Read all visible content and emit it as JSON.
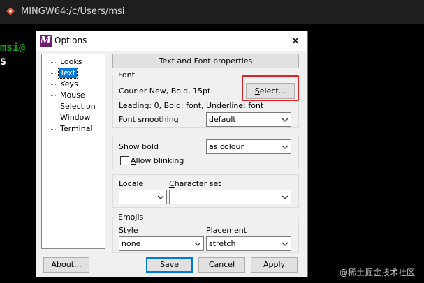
{
  "terminal": {
    "title": "MINGW64:/c/Users/msi",
    "line1": "msi@",
    "line2": "$"
  },
  "dialog": {
    "title": "Options",
    "close_glyph": "✕",
    "tree": [
      "Looks",
      "Text",
      "Keys",
      "Mouse",
      "Selection",
      "Window",
      "Terminal"
    ],
    "tree_selected": "Text",
    "header_button": "Text and Font properties",
    "font_group": {
      "label": "Font",
      "font_desc": "Courier New, Bold, 15pt",
      "select_button": "Select...",
      "leading_desc": "Leading: 0, Bold: font, Underline: font",
      "smoothing_label": "Font smoothing",
      "smoothing_value": "default"
    },
    "bold_group": {
      "show_bold_label": "Show bold",
      "show_bold_value": "as colour",
      "allow_blinking_label": "Allow blinking",
      "allow_blinking_checked": false
    },
    "locale_group": {
      "locale_label": "Locale",
      "locale_value": "",
      "charset_label": "Character set",
      "charset_value": ""
    },
    "emojis_group": {
      "label": "Emojis",
      "style_label": "Style",
      "style_value": "none",
      "placement_label": "Placement",
      "placement_value": "stretch"
    },
    "buttons": {
      "about": "About...",
      "save": "Save",
      "cancel": "Cancel",
      "apply": "Apply"
    }
  },
  "watermark": "@稀土掘金技术社区",
  "colors": {
    "terminal_green": "#13a10e",
    "selection_blue": "#0078d7",
    "highlight_red": "#e02020"
  }
}
